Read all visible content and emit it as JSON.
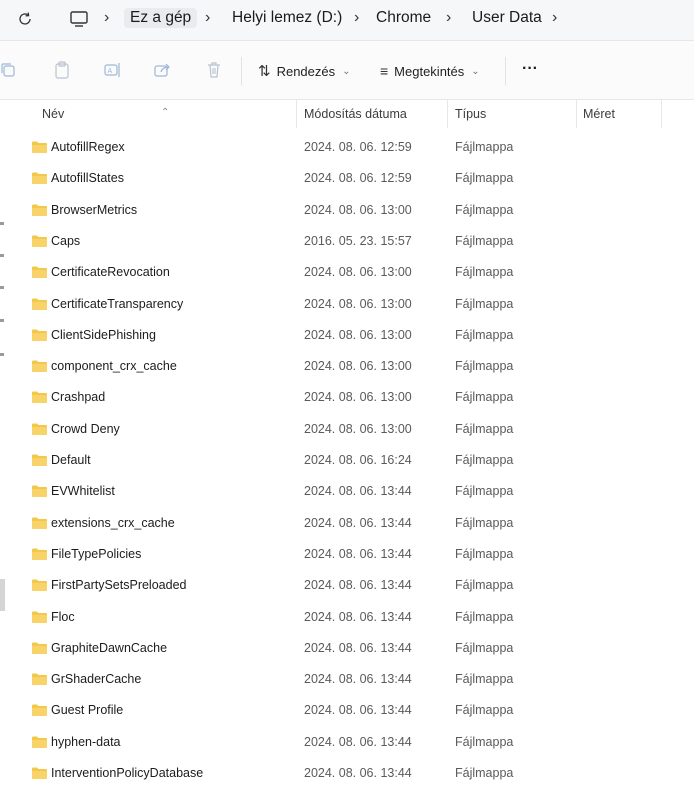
{
  "address": {
    "refresh_icon": "refresh-icon",
    "pc_icon": "monitor-icon",
    "crumbs": [
      "Ez a gép",
      "Helyi lemez (D:)",
      "Chrome",
      "User Data"
    ]
  },
  "toolbar": {
    "sort_label": "Rendezés",
    "view_label": "Megtekintés",
    "more_label": "···"
  },
  "columns": {
    "name": "Név",
    "modified": "Módosítás dátuma",
    "type": "Típus",
    "size": "Méret"
  },
  "files": [
    {
      "name": "AutofillRegex",
      "date": "2024. 08. 06. 12:59",
      "type": "Fájlmappa"
    },
    {
      "name": "AutofillStates",
      "date": "2024. 08. 06. 12:59",
      "type": "Fájlmappa"
    },
    {
      "name": "BrowserMetrics",
      "date": "2024. 08. 06. 13:00",
      "type": "Fájlmappa"
    },
    {
      "name": "Caps",
      "date": "2016. 05. 23. 15:57",
      "type": "Fájlmappa"
    },
    {
      "name": "CertificateRevocation",
      "date": "2024. 08. 06. 13:00",
      "type": "Fájlmappa"
    },
    {
      "name": "CertificateTransparency",
      "date": "2024. 08. 06. 13:00",
      "type": "Fájlmappa"
    },
    {
      "name": "ClientSidePhishing",
      "date": "2024. 08. 06. 13:00",
      "type": "Fájlmappa"
    },
    {
      "name": "component_crx_cache",
      "date": "2024. 08. 06. 13:00",
      "type": "Fájlmappa"
    },
    {
      "name": "Crashpad",
      "date": "2024. 08. 06. 13:00",
      "type": "Fájlmappa"
    },
    {
      "name": "Crowd Deny",
      "date": "2024. 08. 06. 13:00",
      "type": "Fájlmappa"
    },
    {
      "name": "Default",
      "date": "2024. 08. 06. 16:24",
      "type": "Fájlmappa"
    },
    {
      "name": "EVWhitelist",
      "date": "2024. 08. 06. 13:44",
      "type": "Fájlmappa"
    },
    {
      "name": "extensions_crx_cache",
      "date": "2024. 08. 06. 13:44",
      "type": "Fájlmappa"
    },
    {
      "name": "FileTypePolicies",
      "date": "2024. 08. 06. 13:44",
      "type": "Fájlmappa"
    },
    {
      "name": "FirstPartySetsPreloaded",
      "date": "2024. 08. 06. 13:44",
      "type": "Fájlmappa"
    },
    {
      "name": "Floc",
      "date": "2024. 08. 06. 13:44",
      "type": "Fájlmappa"
    },
    {
      "name": "GraphiteDawnCache",
      "date": "2024. 08. 06. 13:44",
      "type": "Fájlmappa"
    },
    {
      "name": "GrShaderCache",
      "date": "2024. 08. 06. 13:44",
      "type": "Fájlmappa"
    },
    {
      "name": "Guest Profile",
      "date": "2024. 08. 06. 13:44",
      "type": "Fájlmappa"
    },
    {
      "name": "hyphen-data",
      "date": "2024. 08. 06. 13:44",
      "type": "Fájlmappa"
    },
    {
      "name": "InterventionPolicyDatabase",
      "date": "2024. 08. 06. 13:44",
      "type": "Fájlmappa"
    }
  ],
  "colors": {
    "folder": "#f2c84b",
    "accent": "#0067c0"
  }
}
